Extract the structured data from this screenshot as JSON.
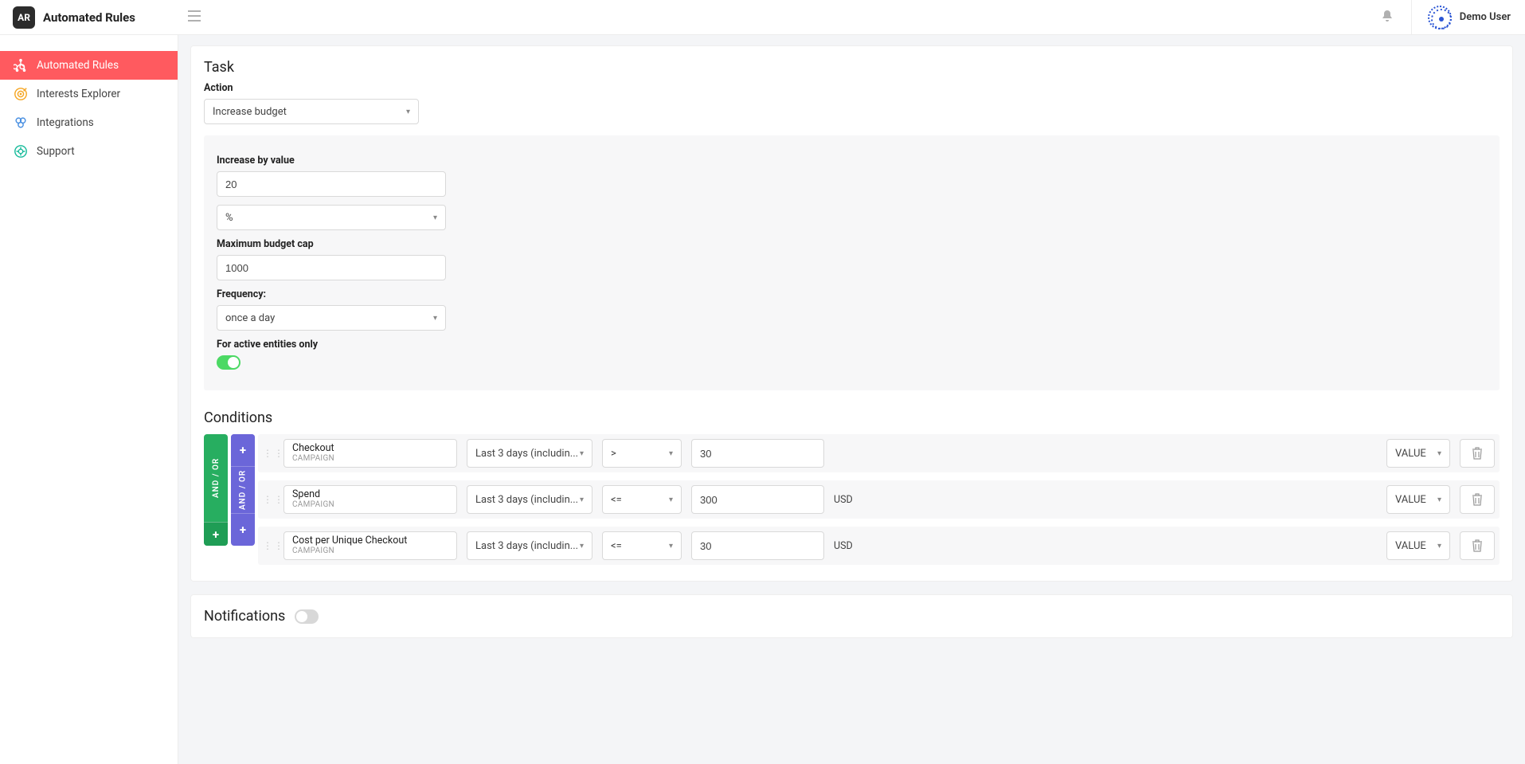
{
  "brand": {
    "initials": "AR",
    "name": "Automated Rules"
  },
  "user": {
    "name": "Demo User"
  },
  "sidebar": {
    "items": [
      {
        "label": "Automated Rules",
        "active": true
      },
      {
        "label": "Interests Explorer",
        "active": false
      },
      {
        "label": "Integrations",
        "active": false
      },
      {
        "label": "Support",
        "active": false
      }
    ]
  },
  "section_task": {
    "title": "Task",
    "action_label": "Action",
    "action_value": "Increase budget"
  },
  "task_panel": {
    "increase_by_label": "Increase by value",
    "increase_by_value": "20",
    "unit_value": "%",
    "max_cap_label": "Maximum budget cap",
    "max_cap_value": "1000",
    "frequency_label": "Frequency:",
    "frequency_value": "once a day",
    "active_only_label": "For active entities only",
    "active_only_on": true
  },
  "section_conditions": {
    "title": "Conditions"
  },
  "group_labels": {
    "left": "AND / OR",
    "inner": "AND / OR",
    "plus": "+"
  },
  "condition_rows": [
    {
      "metric": "Checkout",
      "level": "CAMPAIGN",
      "timeframe": "Last 3 days (includin...",
      "operator": ">",
      "value": "30",
      "suffix": "",
      "value_type": "VALUE"
    },
    {
      "metric": "Spend",
      "level": "CAMPAIGN",
      "timeframe": "Last 3 days (includin...",
      "operator": "<=",
      "value": "300",
      "suffix": "USD",
      "value_type": "VALUE"
    },
    {
      "metric": "Cost per Unique Checkout",
      "level": "CAMPAIGN",
      "timeframe": "Last 3 days (includin...",
      "operator": "<=",
      "value": "30",
      "suffix": "USD",
      "value_type": "VALUE"
    }
  ],
  "section_notifications": {
    "title": "Notifications",
    "enabled": false
  }
}
